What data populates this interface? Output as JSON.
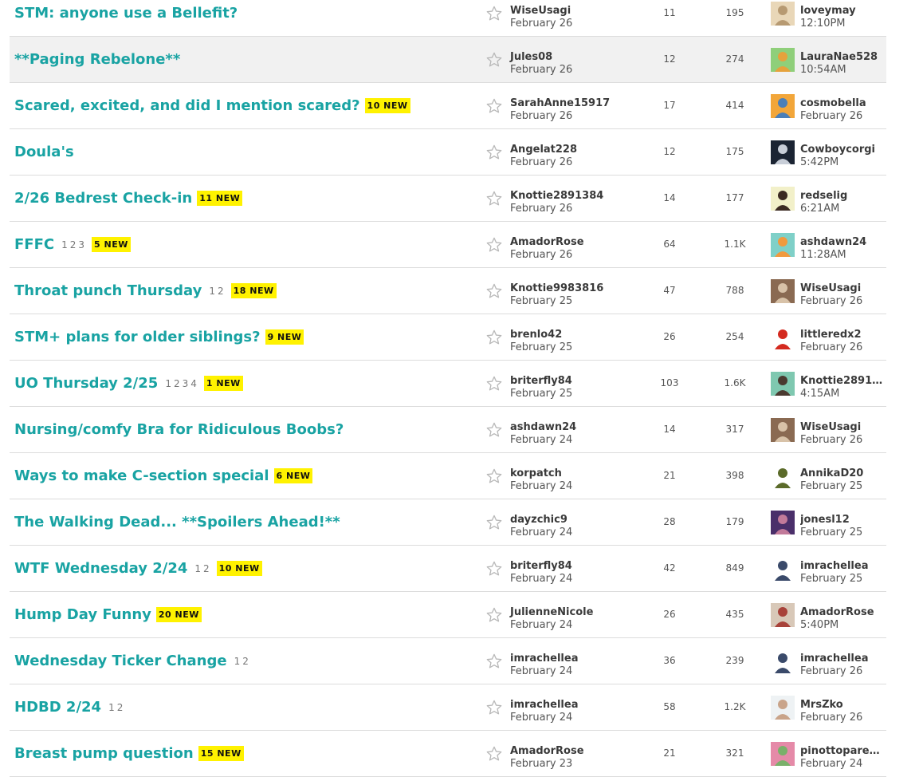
{
  "topics": [
    {
      "title": "STM: anyone use a Bellefit?",
      "pages": [],
      "new_badge": "",
      "author": "WiseUsagi",
      "author_date": "February 26",
      "replies": "11",
      "views": "195",
      "last_user": "loveymay",
      "last_time": "12:10PM",
      "avatar_colors": [
        "#e9d7b8",
        "#b79a72"
      ],
      "highlighted": false
    },
    {
      "title": "**Paging Rebelone**",
      "pages": [],
      "new_badge": "",
      "author": "Jules08",
      "author_date": "February 26",
      "replies": "12",
      "views": "274",
      "last_user": "LauraNae528",
      "last_time": "10:54AM",
      "avatar_colors": [
        "#8fcf7a",
        "#e6a23c"
      ],
      "highlighted": true
    },
    {
      "title": "Scared, excited, and did I mention scared?",
      "pages": [],
      "new_badge": "10 NEW",
      "author": "SarahAnne15917",
      "author_date": "February 26",
      "replies": "17",
      "views": "414",
      "last_user": "cosmobella",
      "last_time": "February 26",
      "avatar_colors": [
        "#f2a63a",
        "#4b7fb8"
      ],
      "highlighted": false
    },
    {
      "title": "Doula's",
      "pages": [],
      "new_badge": "",
      "author": "Angelat228",
      "author_date": "February 26",
      "replies": "12",
      "views": "175",
      "last_user": "Cowboycorgi",
      "last_time": "5:42PM",
      "avatar_colors": [
        "#1b2433",
        "#c8ced8"
      ],
      "highlighted": false
    },
    {
      "title": "2/26 Bedrest Check-in",
      "pages": [],
      "new_badge": "11 NEW",
      "author": "Knottie2891384",
      "author_date": "February 26",
      "replies": "14",
      "views": "177",
      "last_user": "redselig",
      "last_time": "6:21AM",
      "avatar_colors": [
        "#f2f0c9",
        "#3b2a22"
      ],
      "highlighted": false
    },
    {
      "title": "FFFC",
      "pages": [
        "1",
        "2",
        "3"
      ],
      "new_badge": "5 NEW",
      "author": "AmadorRose",
      "author_date": "February 26",
      "replies": "64",
      "views": "1.1K",
      "last_user": "ashdawn24",
      "last_time": "11:28AM",
      "avatar_colors": [
        "#7fd0c8",
        "#f19a3e"
      ],
      "highlighted": false
    },
    {
      "title": "Throat punch Thursday",
      "pages": [
        "1",
        "2"
      ],
      "new_badge": "18 NEW",
      "author": "Knottie9983816",
      "author_date": "February 25",
      "replies": "47",
      "views": "788",
      "last_user": "WiseUsagi",
      "last_time": "February 26",
      "avatar_colors": [
        "#8a6a52",
        "#d8c2a8"
      ],
      "highlighted": false
    },
    {
      "title": "STM+ plans for older siblings?",
      "pages": [],
      "new_badge": "9 NEW",
      "author": "brenlo42",
      "author_date": "February 25",
      "replies": "26",
      "views": "254",
      "last_user": "littleredx2",
      "last_time": "February 26",
      "avatar_colors": [
        "#ffffff",
        "#d42a1f"
      ],
      "highlighted": false
    },
    {
      "title": "UO Thursday 2/25",
      "pages": [
        "1",
        "2",
        "3",
        "4"
      ],
      "new_badge": "1 NEW",
      "author": "briterfly84",
      "author_date": "February 25",
      "replies": "103",
      "views": "1.6K",
      "last_user": "Knottie28913...",
      "last_time": "4:15AM",
      "avatar_colors": [
        "#7fc8b0",
        "#4a3a30"
      ],
      "highlighted": false
    },
    {
      "title": "Nursing/comfy Bra for Ridiculous Boobs?",
      "pages": [],
      "new_badge": "",
      "author": "ashdawn24",
      "author_date": "February 24",
      "replies": "14",
      "views": "317",
      "last_user": "WiseUsagi",
      "last_time": "February 26",
      "avatar_colors": [
        "#8a6a52",
        "#d8c2a8"
      ],
      "highlighted": false
    },
    {
      "title": "Ways to make C-section special",
      "pages": [],
      "new_badge": "6 NEW",
      "author": "korpatch",
      "author_date": "February 24",
      "replies": "21",
      "views": "398",
      "last_user": "AnnikaD20",
      "last_time": "February 25",
      "avatar_colors": [
        "#ffffff",
        "#5b6b2a"
      ],
      "highlighted": false
    },
    {
      "title": "The Walking Dead... **Spoilers Ahead!**",
      "pages": [],
      "new_badge": "",
      "author": "dayzchic9",
      "author_date": "February 24",
      "replies": "28",
      "views": "179",
      "last_user": "jonesl12",
      "last_time": "February 25",
      "avatar_colors": [
        "#4a2f6a",
        "#c27a9a"
      ],
      "highlighted": false
    },
    {
      "title": "WTF Wednesday 2/24",
      "pages": [
        "1",
        "2"
      ],
      "new_badge": "10 NEW",
      "author": "briterfly84",
      "author_date": "February 24",
      "replies": "42",
      "views": "849",
      "last_user": "imrachellea",
      "last_time": "February 25",
      "avatar_colors": [
        "#ffffff",
        "#3a4a6a"
      ],
      "highlighted": false
    },
    {
      "title": "Hump Day Funny",
      "pages": [],
      "new_badge": "20 NEW",
      "author": "JulienneNicole",
      "author_date": "February 24",
      "replies": "26",
      "views": "435",
      "last_user": "AmadorRose",
      "last_time": "5:40PM",
      "avatar_colors": [
        "#d8c8b8",
        "#a8423a"
      ],
      "highlighted": false
    },
    {
      "title": "Wednesday Ticker Change",
      "pages": [
        "1",
        "2"
      ],
      "new_badge": "",
      "author": "imrachellea",
      "author_date": "February 24",
      "replies": "36",
      "views": "239",
      "last_user": "imrachellea",
      "last_time": "February 26",
      "avatar_colors": [
        "#ffffff",
        "#3a4a6a"
      ],
      "highlighted": false
    },
    {
      "title": "HDBD 2/24",
      "pages": [
        "1",
        "2"
      ],
      "new_badge": "",
      "author": "imrachellea",
      "author_date": "February 24",
      "replies": "58",
      "views": "1.2K",
      "last_user": "MrsZko",
      "last_time": "February 26",
      "avatar_colors": [
        "#eef2f4",
        "#c9a48a"
      ],
      "highlighted": false
    },
    {
      "title": "Breast pump question",
      "pages": [],
      "new_badge": "15 NEW",
      "author": "AmadorRose",
      "author_date": "February 23",
      "replies": "21",
      "views": "321",
      "last_user": "pinottoparen...",
      "last_time": "February 24",
      "avatar_colors": [
        "#e58aa8",
        "#7ab06a"
      ],
      "highlighted": false
    }
  ],
  "icons": {
    "follow": "star-outline-icon"
  },
  "colors": {
    "title": "#19a3a3",
    "badge_bg": "#fff200",
    "row_highlight": "#f1f1f1",
    "divider": "#dcdcdc"
  }
}
